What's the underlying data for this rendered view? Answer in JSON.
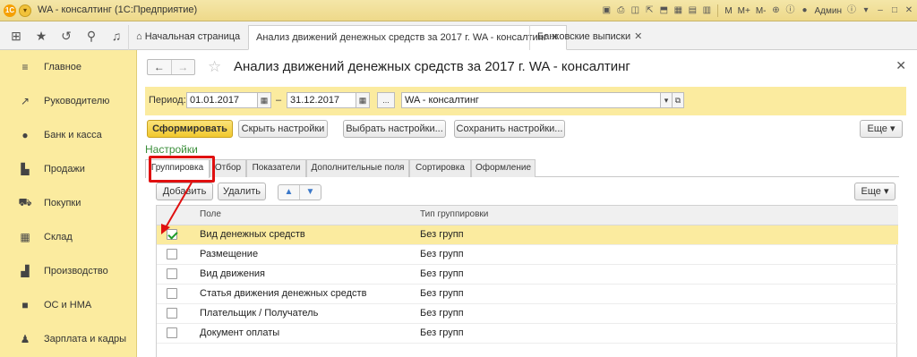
{
  "window": {
    "logo": "1С",
    "title": "WA - консалтинг (1С:Предприятие)",
    "toolbar_text": [
      "M",
      "M+",
      "M-"
    ],
    "user": "Админ"
  },
  "tabs": {
    "home_label": "Начальная страница",
    "items": [
      {
        "label": "Анализ движений денежных средств за 2017 г. WA - консалтинг"
      },
      {
        "label": "Банковские выписки"
      }
    ]
  },
  "sidebar": {
    "items": [
      {
        "label": "Главное",
        "icon": "menu-lines-icon"
      },
      {
        "label": "Руководителю",
        "icon": "trend-icon"
      },
      {
        "label": "Банк и касса",
        "icon": "coin-icon"
      },
      {
        "label": "Продажи",
        "icon": "bag-icon"
      },
      {
        "label": "Покупки",
        "icon": "cart-icon"
      },
      {
        "label": "Склад",
        "icon": "warehouse-icon"
      },
      {
        "label": "Производство",
        "icon": "factory-icon"
      },
      {
        "label": "ОС и НМА",
        "icon": "truck-icon"
      },
      {
        "label": "Зарплата и кадры",
        "icon": "person-icon"
      }
    ]
  },
  "form": {
    "title": "Анализ движений денежных средств за 2017 г. WA - консалтинг",
    "period_label": "Период:",
    "date_from": "01.01.2017",
    "dash": "–",
    "date_to": "31.12.2017",
    "ellipsis": "...",
    "org": "WA - консалтинг",
    "buttons": {
      "generate": "Сформировать",
      "hide_settings": "Скрыть настройки",
      "choose_settings": "Выбрать настройки...",
      "save_settings": "Сохранить настройки...",
      "more": "Еще"
    },
    "settings_label": "Настройки",
    "settings_tabs": [
      "Группировка",
      "Отбор",
      "Показатели",
      "Дополнительные поля",
      "Сортировка",
      "Оформление"
    ],
    "grid_toolbar": {
      "add": "Добавить",
      "delete": "Удалить",
      "more": "Еще"
    },
    "grid": {
      "columns": [
        "Поле",
        "Тип группировки"
      ],
      "rows": [
        {
          "field": "Вид денежных средств",
          "type": "Без групп",
          "checked": true,
          "selected": true
        },
        {
          "field": "Размещение",
          "type": "Без групп",
          "checked": false,
          "selected": false
        },
        {
          "field": "Вид движения",
          "type": "Без групп",
          "checked": false,
          "selected": false
        },
        {
          "field": "Статья движения денежных средств",
          "type": "Без групп",
          "checked": false,
          "selected": false
        },
        {
          "field": "Плательщик / Получатель",
          "type": "Без групп",
          "checked": false,
          "selected": false
        },
        {
          "field": "Документ оплаты",
          "type": "Без групп",
          "checked": false,
          "selected": false
        }
      ]
    }
  },
  "colors": {
    "accent": "#fbeb9f",
    "highlight": "#e01010",
    "primary_button": "#f1c82e",
    "settings_link": "#3a8e3a"
  }
}
